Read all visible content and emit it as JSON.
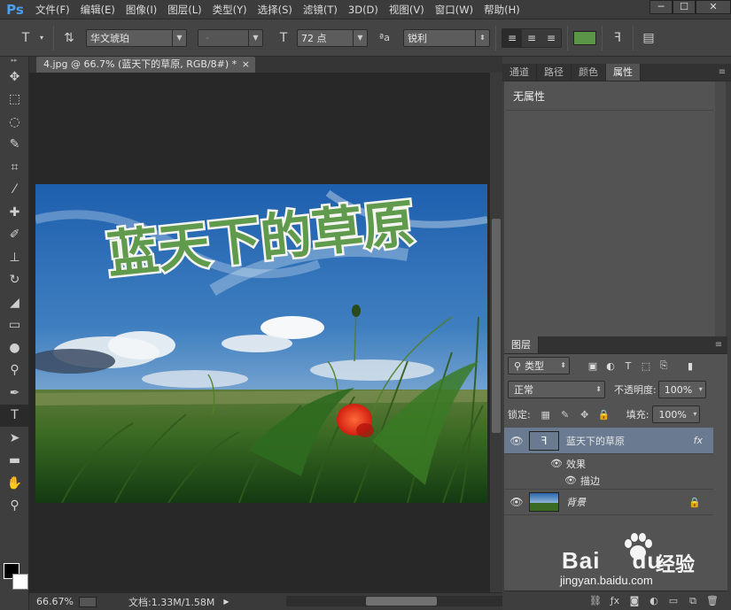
{
  "app": {
    "logo": "Ps"
  },
  "menu": [
    "文件(F)",
    "编辑(E)",
    "图像(I)",
    "图层(L)",
    "类型(Y)",
    "选择(S)",
    "滤镜(T)",
    "3D(D)",
    "视图(V)",
    "窗口(W)",
    "帮助(H)"
  ],
  "window_controls": {
    "minimize": "─",
    "restore": "☐",
    "close": "✕"
  },
  "options": {
    "font_family": "华文琥珀",
    "font_style": "-",
    "font_size": "72 点",
    "aa_label": "ªa",
    "antialias": "锐利",
    "text_color": "#5b9648"
  },
  "document": {
    "tab_title": "4.jpg @ 66.7% (蓝天下的草原, RGB/8#) *",
    "tab_close": "×",
    "zoom": "66.67%",
    "doc_info": "文档:1.33M/1.58M",
    "art_text": "蓝天下的草原"
  },
  "panels": {
    "top_tabs": [
      "通道",
      "路径",
      "颜色",
      "属性"
    ],
    "active_top_tab": "属性",
    "properties_title": "无属性",
    "layers_tab": "图层",
    "filter_kind": "类型",
    "blend_mode": "正常",
    "opacity_label": "不透明度:",
    "opacity": "100%",
    "lock_label": "锁定:",
    "fill_label": "填充:",
    "fill": "100%",
    "layers": [
      {
        "name": "蓝天下的草原",
        "kind": "text",
        "fx": "fx",
        "selected": true
      },
      {
        "name": "背景",
        "kind": "image",
        "locked": true
      }
    ],
    "effects_label": "效果",
    "stroke_label": "描边"
  },
  "watermark": {
    "logo": "Bai",
    "du": "du",
    "brand": "经验",
    "url": "jingyan.baidu.com"
  }
}
